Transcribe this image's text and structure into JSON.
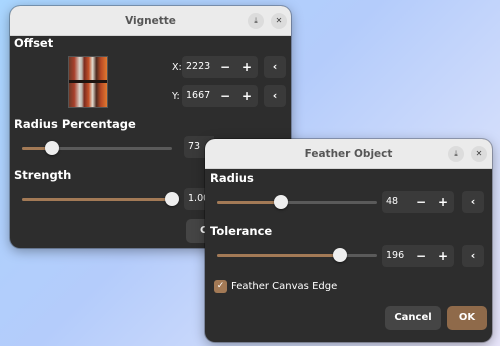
{
  "vignette": {
    "title": "Vignette",
    "offset_label": "Offset",
    "x_label": "X:",
    "x_value": "2223",
    "y_label": "Y:",
    "y_value": "1667",
    "radius_label": "Radius Percentage",
    "radius_value": "73",
    "radius_fraction": 0.2,
    "strength_label": "Strength",
    "strength_value": "1.00",
    "strength_fraction": 1.0,
    "button_partial": "C"
  },
  "feather": {
    "title": "Feather Object",
    "radius_label": "Radius",
    "radius_value": "48",
    "radius_fraction": 0.4,
    "tolerance_label": "Tolerance",
    "tolerance_value": "196",
    "tolerance_fraction": 0.77,
    "checkbox_label": "Feather Canvas Edge",
    "checkbox_checked": true,
    "cancel_label": "Cancel",
    "ok_label": "OK"
  },
  "glyphs": {
    "minus": "−",
    "plus": "+",
    "back": "‹",
    "download": "⤓",
    "close": "✕",
    "check": "✓"
  },
  "colors": {
    "accent": "#a37a56",
    "ok_button": "#8f6a4a",
    "window_bg": "#2d2d2d",
    "titlebar_bg": "#ebebeb"
  }
}
